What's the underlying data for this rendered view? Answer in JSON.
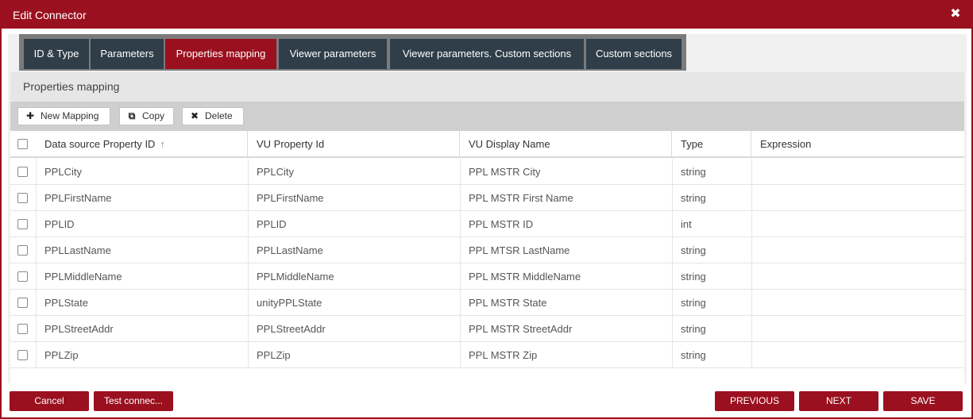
{
  "dialog": {
    "title": "Edit Connector",
    "close_icon": "close-icon"
  },
  "tabs": [
    {
      "label": "ID & Type"
    },
    {
      "label": "Parameters"
    },
    {
      "label": "Properties mapping",
      "active": true
    },
    {
      "label": "Viewer parameters"
    },
    {
      "label": "Viewer parameters. Custom sections"
    },
    {
      "label": "Custom sections"
    }
  ],
  "panel": {
    "title": "Properties mapping"
  },
  "toolbar": {
    "new_mapping": "New Mapping",
    "copy": "Copy",
    "delete": "Delete"
  },
  "grid": {
    "columns": [
      "Data source Property ID",
      "VU Property Id",
      "VU Display Name",
      "Type",
      "Expression"
    ],
    "sort_icon": "sort-ascending-icon",
    "rows": [
      {
        "ds_id": "PPLCity",
        "vu_id": "PPLCity",
        "display": "PPL MSTR City",
        "type": "string",
        "expr": ""
      },
      {
        "ds_id": "PPLFirstName",
        "vu_id": "PPLFirstName",
        "display": "PPL MSTR First Name",
        "type": "string",
        "expr": ""
      },
      {
        "ds_id": "PPLID",
        "vu_id": "PPLID",
        "display": "PPL MSTR ID",
        "type": "int",
        "expr": ""
      },
      {
        "ds_id": "PPLLastName",
        "vu_id": "PPLLastName",
        "display": "PPL MTSR LastName",
        "type": "string",
        "expr": ""
      },
      {
        "ds_id": "PPLMiddleName",
        "vu_id": "PPLMiddleName",
        "display": "PPL MSTR MiddleName",
        "type": "string",
        "expr": ""
      },
      {
        "ds_id": "PPLState",
        "vu_id": "unityPPLState",
        "display": "PPL MSTR State",
        "type": "string",
        "expr": ""
      },
      {
        "ds_id": "PPLStreetAddr",
        "vu_id": "PPLStreetAddr",
        "display": "PPL MSTR StreetAddr",
        "type": "string",
        "expr": ""
      },
      {
        "ds_id": "PPLZip",
        "vu_id": "PPLZip",
        "display": "PPL MSTR Zip",
        "type": "string",
        "expr": ""
      }
    ]
  },
  "footer": {
    "cancel": "Cancel",
    "test": "Test connec...",
    "previous": "PREVIOUS",
    "next": "NEXT",
    "save": "SAVE"
  },
  "colors": {
    "brand": "#9b101f",
    "tab": "#2f3e48"
  }
}
